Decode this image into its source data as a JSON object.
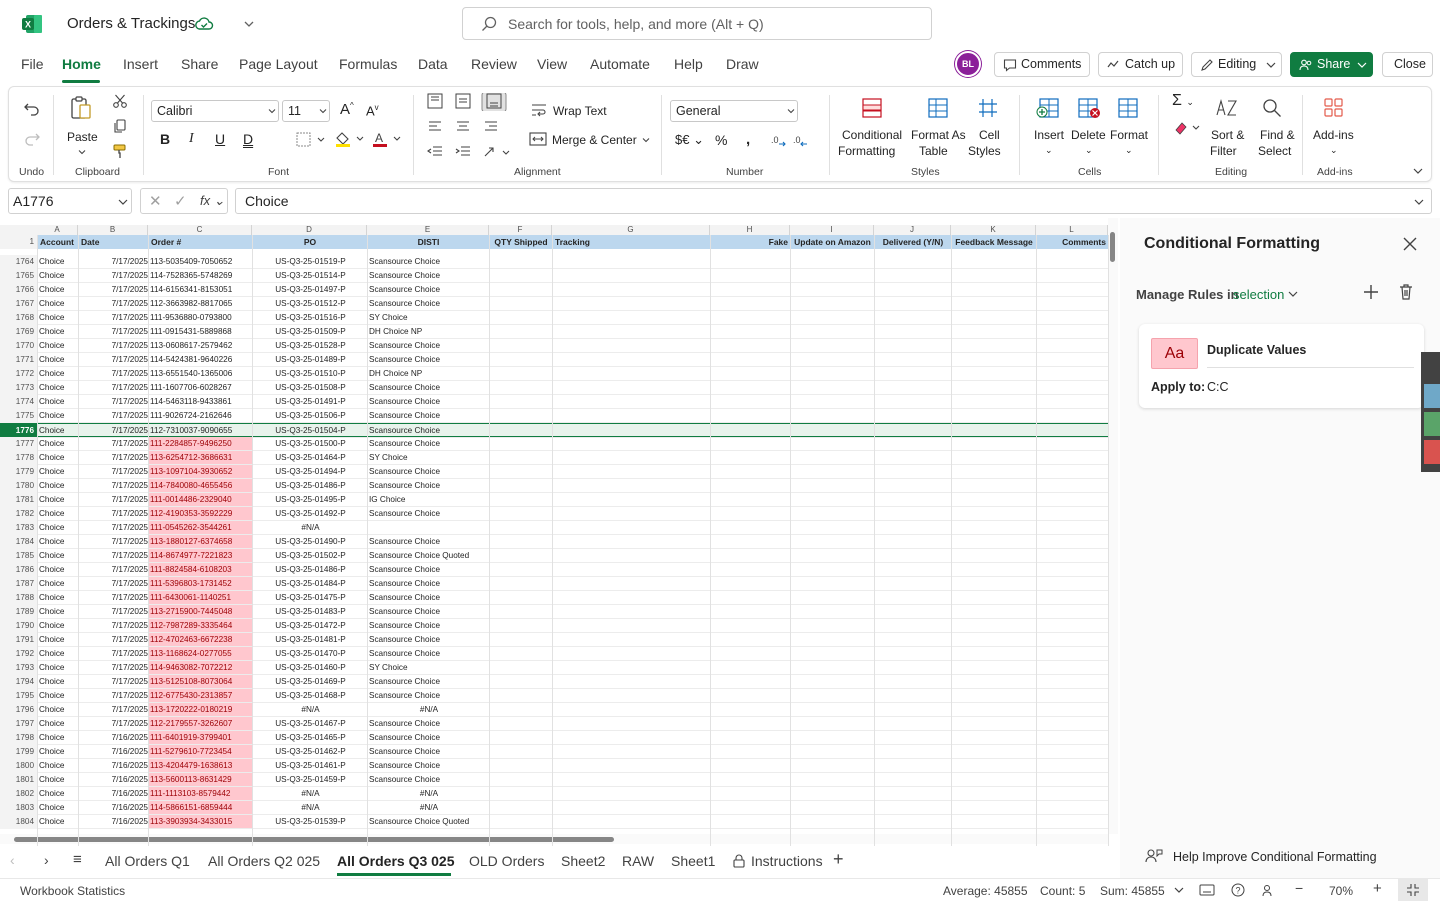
{
  "title_bar": {
    "doc_title": "Orders & Trackings",
    "search_placeholder": "Search for tools, help, and more (Alt + Q)"
  },
  "menu": [
    "File",
    "Home",
    "Insert",
    "Share",
    "Page Layout",
    "Formulas",
    "Data",
    "Review",
    "View",
    "Automate",
    "Help",
    "Draw"
  ],
  "top_right": {
    "avatar": "BL",
    "comments": "Comments",
    "catch_up": "Catch up",
    "editing": "Editing",
    "share": "Share",
    "close": "Close"
  },
  "ribbon": {
    "undo_label": "Undo",
    "paste": "Paste",
    "clipboard": "Clipboard",
    "font_name": "Calibri",
    "font_size": "11",
    "font": "Font",
    "wrap_text": "Wrap Text",
    "merge_center": "Merge & Center",
    "alignment": "Alignment",
    "number_format": "General",
    "number": "Number",
    "cond_fmt_1": "Conditional",
    "cond_fmt_2": "Formatting",
    "fmt_table_1": "Format As",
    "fmt_table_2": "Table",
    "cell_styles_1": "Cell",
    "cell_styles_2": "Styles",
    "styles": "Styles",
    "insert": "Insert",
    "delete": "Delete",
    "format": "Format",
    "cells": "Cells",
    "sort_1": "Sort &",
    "sort_2": "Filter",
    "find_1": "Find &",
    "find_2": "Select",
    "editing": "Editing",
    "addins": "Add-ins",
    "addins_group": "Add-ins"
  },
  "formula_bar": {
    "name_box": "A1776",
    "formula": "Choice"
  },
  "grid": {
    "columns": [
      "A",
      "B",
      "C",
      "D",
      "E",
      "F",
      "G",
      "H",
      "I",
      "J",
      "K",
      "L"
    ],
    "headers": [
      "Account",
      "Date",
      "Order #",
      "PO",
      "DISTI",
      "QTY Shipped",
      "Tracking",
      "Fake",
      "Update on Amazon",
      "Delivered (Y/N)",
      "Feedback Message",
      "Comments"
    ],
    "rows": [
      {
        "n": "1764",
        "a": "Choice",
        "b": "7/17/2025",
        "c": "113-5035409-7050652",
        "d": "US-Q3-25-01519-P",
        "e": "Scansource Choice",
        "dup": false
      },
      {
        "n": "1765",
        "a": "Choice",
        "b": "7/17/2025",
        "c": "114-7528365-5748269",
        "d": "US-Q3-25-01514-P",
        "e": "Scansource Choice",
        "dup": false
      },
      {
        "n": "1766",
        "a": "Choice",
        "b": "7/17/2025",
        "c": "114-6156341-8153051",
        "d": "US-Q3-25-01497-P",
        "e": "Scansource Choice",
        "dup": false
      },
      {
        "n": "1767",
        "a": "Choice",
        "b": "7/17/2025",
        "c": "112-3663982-8817065",
        "d": "US-Q3-25-01512-P",
        "e": "Scansource Choice",
        "dup": false
      },
      {
        "n": "1768",
        "a": "Choice",
        "b": "7/17/2025",
        "c": "111-9536880-0793800",
        "d": "US-Q3-25-01516-P",
        "e": "SY Choice",
        "dup": false
      },
      {
        "n": "1769",
        "a": "Choice",
        "b": "7/17/2025",
        "c": "111-0915431-5889868",
        "d": "US-Q3-25-01509-P",
        "e": "DH Choice NP",
        "dup": false
      },
      {
        "n": "1770",
        "a": "Choice",
        "b": "7/17/2025",
        "c": "113-0608617-2579462",
        "d": "US-Q3-25-01528-P",
        "e": "Scansource Choice",
        "dup": false
      },
      {
        "n": "1771",
        "a": "Choice",
        "b": "7/17/2025",
        "c": "114-5424381-9640226",
        "d": "US-Q3-25-01489-P",
        "e": "Scansource Choice",
        "dup": false
      },
      {
        "n": "1772",
        "a": "Choice",
        "b": "7/17/2025",
        "c": "113-6551540-1365006",
        "d": "US-Q3-25-01510-P",
        "e": "DH Choice NP",
        "dup": false
      },
      {
        "n": "1773",
        "a": "Choice",
        "b": "7/17/2025",
        "c": "111-1607706-6028267",
        "d": "US-Q3-25-01508-P",
        "e": "Scansource Choice",
        "dup": false
      },
      {
        "n": "1774",
        "a": "Choice",
        "b": "7/17/2025",
        "c": "114-5463118-9433861",
        "d": "US-Q3-25-01491-P",
        "e": "Scansource Choice",
        "dup": false
      },
      {
        "n": "1775",
        "a": "Choice",
        "b": "7/17/2025",
        "c": "111-9026724-2162646",
        "d": "US-Q3-25-01506-P",
        "e": "Scansource Choice",
        "dup": false
      },
      {
        "n": "1776",
        "a": "Choice",
        "b": "7/17/2025",
        "c": "112-7310037-9090655",
        "d": "US-Q3-25-01504-P",
        "e": "Scansource Choice",
        "dup": false
      },
      {
        "n": "1777",
        "a": "Choice",
        "b": "7/17/2025",
        "c": "111-2284857-9496250",
        "d": "US-Q3-25-01500-P",
        "e": "Scansource Choice",
        "dup": true
      },
      {
        "n": "1778",
        "a": "Choice",
        "b": "7/17/2025",
        "c": "113-6254712-3686631",
        "d": "US-Q3-25-01464-P",
        "e": "SY Choice",
        "dup": true
      },
      {
        "n": "1779",
        "a": "Choice",
        "b": "7/17/2025",
        "c": "113-1097104-3930652",
        "d": "US-Q3-25-01494-P",
        "e": "Scansource Choice",
        "dup": true
      },
      {
        "n": "1780",
        "a": "Choice",
        "b": "7/17/2025",
        "c": "114-7840080-4655456",
        "d": "US-Q3-25-01486-P",
        "e": "Scansource Choice",
        "dup": true
      },
      {
        "n": "1781",
        "a": "Choice",
        "b": "7/17/2025",
        "c": "111-0014486-2329040",
        "d": "US-Q3-25-01495-P",
        "e": "IG Choice",
        "dup": true
      },
      {
        "n": "1782",
        "a": "Choice",
        "b": "7/17/2025",
        "c": "112-4190353-3592229",
        "d": "US-Q3-25-01492-P",
        "e": "Scansource Choice",
        "dup": true
      },
      {
        "n": "1783",
        "a": "Choice",
        "b": "7/17/2025",
        "c": "111-0545262-3544261",
        "d": "#N/A",
        "e": "",
        "dup": true
      },
      {
        "n": "1784",
        "a": "Choice",
        "b": "7/17/2025",
        "c": "113-1880127-6374658",
        "d": "US-Q3-25-01490-P",
        "e": "Scansource Choice",
        "dup": true
      },
      {
        "n": "1785",
        "a": "Choice",
        "b": "7/17/2025",
        "c": "114-8674977-7221823",
        "d": "US-Q3-25-01502-P",
        "e": "Scansource Choice Quoted",
        "dup": true
      },
      {
        "n": "1786",
        "a": "Choice",
        "b": "7/17/2025",
        "c": "111-8824584-6108203",
        "d": "US-Q3-25-01486-P",
        "e": "Scansource Choice",
        "dup": true
      },
      {
        "n": "1787",
        "a": "Choice",
        "b": "7/17/2025",
        "c": "111-5396803-1731452",
        "d": "US-Q3-25-01484-P",
        "e": "Scansource Choice",
        "dup": true
      },
      {
        "n": "1788",
        "a": "Choice",
        "b": "7/17/2025",
        "c": "111-6430061-1140251",
        "d": "US-Q3-25-01475-P",
        "e": "Scansource Choice",
        "dup": true
      },
      {
        "n": "1789",
        "a": "Choice",
        "b": "7/17/2025",
        "c": "113-2715900-7445048",
        "d": "US-Q3-25-01483-P",
        "e": "Scansource Choice",
        "dup": true
      },
      {
        "n": "1790",
        "a": "Choice",
        "b": "7/17/2025",
        "c": "112-7987289-3335464",
        "d": "US-Q3-25-01472-P",
        "e": "Scansource Choice",
        "dup": true
      },
      {
        "n": "1791",
        "a": "Choice",
        "b": "7/17/2025",
        "c": "112-4702463-6672238",
        "d": "US-Q3-25-01481-P",
        "e": "Scansource Choice",
        "dup": true
      },
      {
        "n": "1792",
        "a": "Choice",
        "b": "7/17/2025",
        "c": "113-1168624-0277055",
        "d": "US-Q3-25-01470-P",
        "e": "Scansource Choice",
        "dup": true
      },
      {
        "n": "1793",
        "a": "Choice",
        "b": "7/17/2025",
        "c": "114-9463082-7072212",
        "d": "US-Q3-25-01460-P",
        "e": "SY Choice",
        "dup": true
      },
      {
        "n": "1794",
        "a": "Choice",
        "b": "7/17/2025",
        "c": "113-5125108-8073064",
        "d": "US-Q3-25-01469-P",
        "e": "Scansource Choice",
        "dup": true
      },
      {
        "n": "1795",
        "a": "Choice",
        "b": "7/17/2025",
        "c": "112-6775430-2313857",
        "d": "US-Q3-25-01468-P",
        "e": "Scansource Choice",
        "dup": true
      },
      {
        "n": "1796",
        "a": "Choice",
        "b": "7/17/2025",
        "c": "113-1720222-0180219",
        "d": "#N/A",
        "e": "#N/A",
        "dup": true
      },
      {
        "n": "1797",
        "a": "Choice",
        "b": "7/17/2025",
        "c": "112-2179557-3262607",
        "d": "US-Q3-25-01467-P",
        "e": "Scansource Choice",
        "dup": true
      },
      {
        "n": "1798",
        "a": "Choice",
        "b": "7/16/2025",
        "c": "111-6401919-3799401",
        "d": "US-Q3-25-01465-P",
        "e": "Scansource Choice",
        "dup": true
      },
      {
        "n": "1799",
        "a": "Choice",
        "b": "7/16/2025",
        "c": "111-5279610-7723454",
        "d": "US-Q3-25-01462-P",
        "e": "Scansource Choice",
        "dup": true
      },
      {
        "n": "1800",
        "a": "Choice",
        "b": "7/16/2025",
        "c": "113-4204479-1638613",
        "d": "US-Q3-25-01461-P",
        "e": "Scansource Choice",
        "dup": true
      },
      {
        "n": "1801",
        "a": "Choice",
        "b": "7/16/2025",
        "c": "113-5600113-8631429",
        "d": "US-Q3-25-01459-P",
        "e": "Scansource Choice",
        "dup": true
      },
      {
        "n": "1802",
        "a": "Choice",
        "b": "7/16/2025",
        "c": "111-1113103-8579442",
        "d": "#N/A",
        "e": "#N/A",
        "dup": true
      },
      {
        "n": "1803",
        "a": "Choice",
        "b": "7/16/2025",
        "c": "114-5866151-6859444",
        "d": "#N/A",
        "e": "#N/A",
        "dup": true
      },
      {
        "n": "1804",
        "a": "Choice",
        "b": "7/16/2025",
        "c": "113-3903934-3433015",
        "d": "US-Q3-25-01539-P",
        "e": "Scansource Choice Quoted",
        "dup": true
      }
    ]
  },
  "panel": {
    "title": "Conditional Formatting",
    "manage_rules": "Manage Rules in",
    "scope": "selection",
    "rule_preview": "Aa",
    "rule_name": "Duplicate Values",
    "apply_to_label": "Apply to:",
    "apply_to_value": "C:C",
    "help_improve": "Help Improve Conditional Formatting"
  },
  "tabs": [
    "All Orders Q1",
    "All Orders Q2 025",
    "All Orders Q3 025",
    "OLD Orders",
    "Sheet2",
    "RAW",
    "Sheet1",
    "Instructions"
  ],
  "status": {
    "workbook_stats": "Workbook Statistics",
    "average": "Average: 45855",
    "count": "Count: 5",
    "sum": "Sum: 45855",
    "zoom": "70%"
  },
  "colors": {
    "brand": "#107c41",
    "dup_fill": "#ffc7ce",
    "dup_text": "#9c0006",
    "header_fill": "#bcd7ee",
    "avatar": "#8b1f99"
  }
}
